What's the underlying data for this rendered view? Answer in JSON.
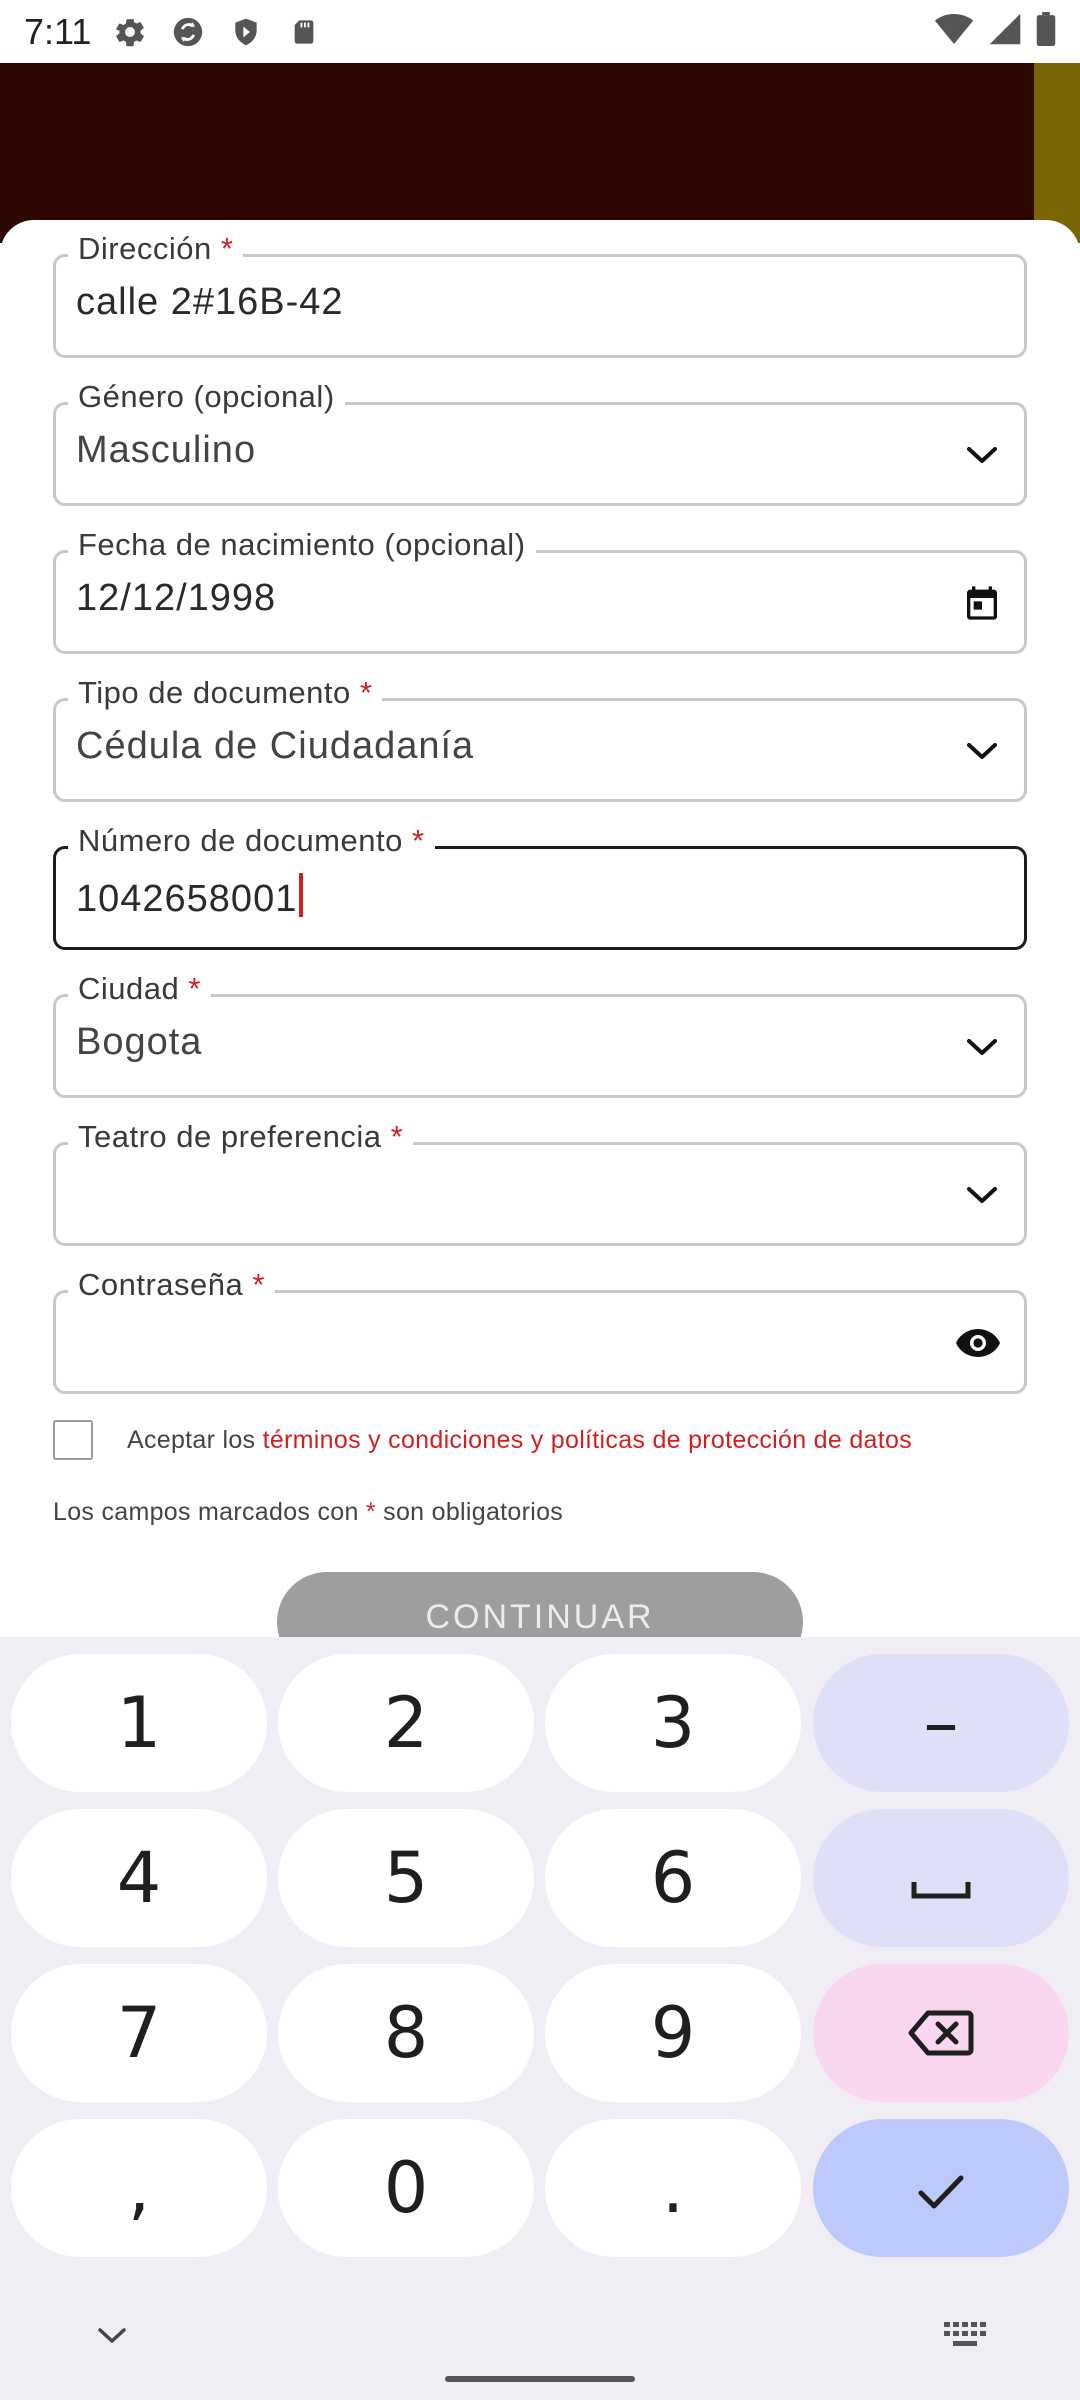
{
  "status_bar": {
    "time": "7:11",
    "left_icons": [
      "settings-icon",
      "sync-icon",
      "shield-play-icon",
      "sd-card-icon"
    ],
    "right_icons": [
      "wifi-icon",
      "signal-icon",
      "battery-icon"
    ]
  },
  "colors": {
    "header_bg": "#2e0703",
    "header_accent": "#7a6505",
    "required_mark": "#d21f1f",
    "link": "#d21f1f",
    "continue_disabled": "#9e9e9e",
    "key_function": "#dfe0f8",
    "key_delete": "#fad7f1",
    "key_enter": "#bdc9fa"
  },
  "form": {
    "address": {
      "label": "Dirección",
      "required_mark": "*",
      "value": "calle 2#16B-42"
    },
    "gender": {
      "label": "Género (opcional)",
      "value": "Masculino",
      "icon": "chevron-down-icon"
    },
    "birth_date": {
      "label": "Fecha de nacimiento (opcional)",
      "value": "12/12/1998",
      "icon": "calendar-icon"
    },
    "document_type": {
      "label": "Tipo de documento",
      "required_mark": "*",
      "value": "Cédula de Ciudadanía",
      "icon": "chevron-down-icon"
    },
    "document_number": {
      "label": "Número de documento",
      "required_mark": "*",
      "value": "1042658001"
    },
    "city": {
      "label": "Ciudad",
      "required_mark": "*",
      "value": "Bogota",
      "icon": "chevron-down-icon"
    },
    "theater": {
      "label": "Teatro de preferencia",
      "required_mark": "*",
      "value": "",
      "icon": "chevron-down-icon"
    },
    "password": {
      "label": "Contraseña",
      "required_mark": "*",
      "value": "",
      "icon": "eye-icon"
    },
    "terms": {
      "prefix": "Aceptar los ",
      "link": "términos y condiciones y políticas de protección de datos",
      "checked": false
    },
    "required_note": {
      "before": "Los campos marcados con ",
      "mark": "*",
      "after": " son obligatorios"
    },
    "continue_label": "CONTINUAR"
  },
  "keyboard": {
    "rows": [
      [
        "1",
        "2",
        "3",
        "–"
      ],
      [
        "4",
        "5",
        "6",
        "space-icon"
      ],
      [
        "7",
        "8",
        "9",
        "backspace-icon"
      ],
      [
        ",",
        "0",
        ".",
        "check-icon"
      ]
    ],
    "keys": {
      "k1": "1",
      "k2": "2",
      "k3": "3",
      "dash": "–",
      "k4": "4",
      "k5": "5",
      "k6": "6",
      "k7": "7",
      "k8": "8",
      "k9": "9",
      "comma": ",",
      "k0": "0",
      "period": "."
    },
    "bottom_left_icon": "chevron-down-icon",
    "bottom_right_icon": "keyboard-icon"
  }
}
